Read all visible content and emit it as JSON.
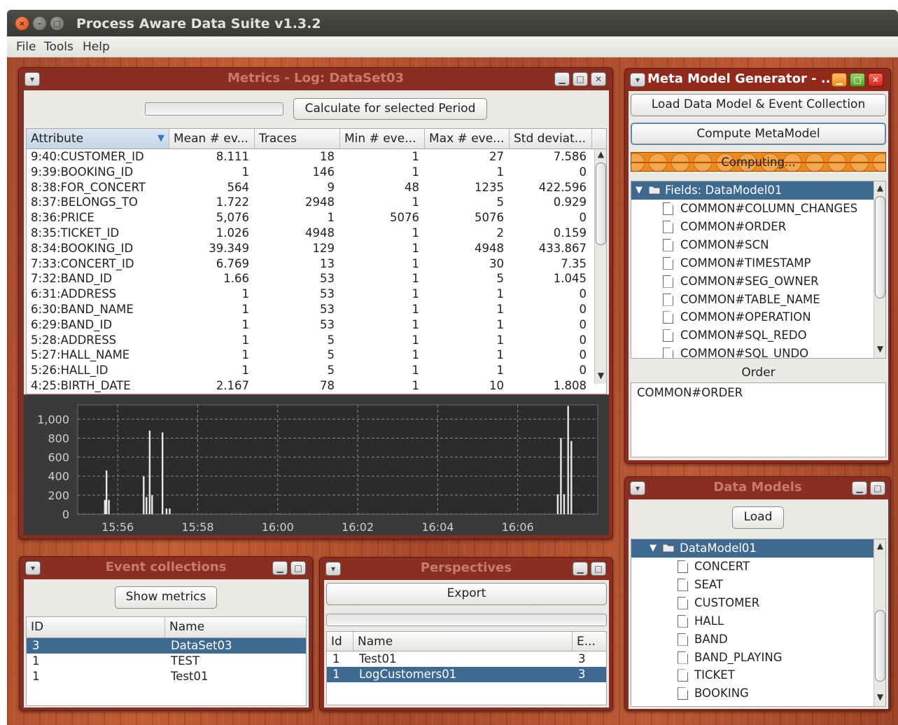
{
  "window": {
    "title": "Process Aware Data Suite v1.3.2",
    "close_glyph": "×",
    "min_glyph": "–",
    "max_glyph": "□"
  },
  "menu": {
    "items": [
      "File",
      "Tools",
      "Help"
    ]
  },
  "metrics": {
    "title": "Metrics - Log: DataSet03",
    "calculate_button": "Calculate for selected Period",
    "columns": [
      "Attribute",
      "Mean # ev...",
      "Traces",
      "Min # eve...",
      "Max # eve...",
      "Std deviat..."
    ],
    "rows": [
      [
        "9:40:CUSTOMER_ID",
        "8.111",
        "18",
        "1",
        "27",
        "7.586"
      ],
      [
        "9:39:BOOKING_ID",
        "1",
        "146",
        "1",
        "1",
        "0"
      ],
      [
        "8:38:FOR_CONCERT",
        "564",
        "9",
        "48",
        "1235",
        "422.596"
      ],
      [
        "8:37:BELONGS_TO",
        "1.722",
        "2948",
        "1",
        "5",
        "0.929"
      ],
      [
        "8:36:PRICE",
        "5,076",
        "1",
        "5076",
        "5076",
        "0"
      ],
      [
        "8:35:TICKET_ID",
        "1.026",
        "4948",
        "1",
        "2",
        "0.159"
      ],
      [
        "8:34:BOOKING_ID",
        "39.349",
        "129",
        "1",
        "4948",
        "433.867"
      ],
      [
        "7:33:CONCERT_ID",
        "6.769",
        "13",
        "1",
        "30",
        "7.35"
      ],
      [
        "7:32:BAND_ID",
        "1.66",
        "53",
        "1",
        "5",
        "1.045"
      ],
      [
        "6:31:ADDRESS",
        "1",
        "53",
        "1",
        "1",
        "0"
      ],
      [
        "6:30:BAND_NAME",
        "1",
        "53",
        "1",
        "1",
        "0"
      ],
      [
        "6:29:BAND_ID",
        "1",
        "53",
        "1",
        "1",
        "0"
      ],
      [
        "5:28:ADDRESS",
        "1",
        "5",
        "1",
        "1",
        "0"
      ],
      [
        "5:27:HALL_NAME",
        "1",
        "5",
        "1",
        "1",
        "0"
      ],
      [
        "5:26:HALL_ID",
        "1",
        "5",
        "1",
        "1",
        "0"
      ],
      [
        "4:25:BIRTH_DATE",
        "2.167",
        "78",
        "1",
        "10",
        "1.808"
      ]
    ]
  },
  "chart_data": {
    "type": "bar",
    "title": "",
    "xlabel": "",
    "ylabel": "",
    "x_ticks": [
      "15:56",
      "15:58",
      "16:00",
      "16:02",
      "16:04",
      "16:06"
    ],
    "y_ticks": [
      "0",
      "200",
      "400",
      "600",
      "800",
      "1,000"
    ],
    "ylim": [
      0,
      1150
    ],
    "xlim_minutes": [
      0,
      13
    ],
    "grid": true,
    "bars": [
      {
        "t": 0.68,
        "v": 150
      },
      {
        "t": 0.72,
        "v": 460
      },
      {
        "t": 0.78,
        "v": 150
      },
      {
        "t": 1.65,
        "v": 400
      },
      {
        "t": 1.72,
        "v": 180
      },
      {
        "t": 1.8,
        "v": 880
      },
      {
        "t": 1.86,
        "v": 200
      },
      {
        "t": 2.12,
        "v": 860
      },
      {
        "t": 2.22,
        "v": 60
      },
      {
        "t": 2.3,
        "v": 60
      },
      {
        "t": 12.0,
        "v": 210
      },
      {
        "t": 12.08,
        "v": 800
      },
      {
        "t": 12.16,
        "v": 210
      },
      {
        "t": 12.26,
        "v": 1140
      },
      {
        "t": 12.34,
        "v": 770
      }
    ]
  },
  "meta_model": {
    "title": "Meta Model Generator - ...",
    "load_button": "Load Data Model & Event Collection",
    "compute_button": "Compute MetaModel",
    "status": "Computing...",
    "tree_root": "Fields: DataModel01",
    "fields": [
      "COMMON#COLUMN_CHANGES",
      "COMMON#ORDER",
      "COMMON#SCN",
      "COMMON#TIMESTAMP",
      "COMMON#SEG_OWNER",
      "COMMON#TABLE_NAME",
      "COMMON#OPERATION",
      "COMMON#SQL_REDO",
      "COMMON#SQL_UNDO"
    ],
    "selected_label": "Order",
    "selected_value": "COMMON#ORDER"
  },
  "data_models": {
    "title": "Data Models",
    "load_button": "Load",
    "tree_root": "DataModel01",
    "items": [
      "CONCERT",
      "SEAT",
      "CUSTOMER",
      "HALL",
      "BAND",
      "BAND_PLAYING",
      "TICKET",
      "BOOKING"
    ]
  },
  "event_collections": {
    "title": "Event collections",
    "show_metrics_button": "Show metrics",
    "columns": [
      "ID",
      "Name"
    ],
    "rows": [
      [
        "3",
        "DataSet03"
      ],
      [
        "1",
        "TEST"
      ],
      [
        "1",
        "Test01"
      ]
    ],
    "selected_index": 0
  },
  "perspectives": {
    "title": "Perspectives",
    "export_button": "Export",
    "columns": [
      "Id",
      "Name",
      "E..."
    ],
    "rows": [
      [
        "1",
        "Test01",
        "3"
      ],
      [
        "1",
        "LogCustomers01",
        "3"
      ]
    ],
    "selected_index": 1
  },
  "colors": {
    "selection": "#3e6990",
    "frame": "#8a2e22",
    "progress_orange": "#f08a1c"
  }
}
